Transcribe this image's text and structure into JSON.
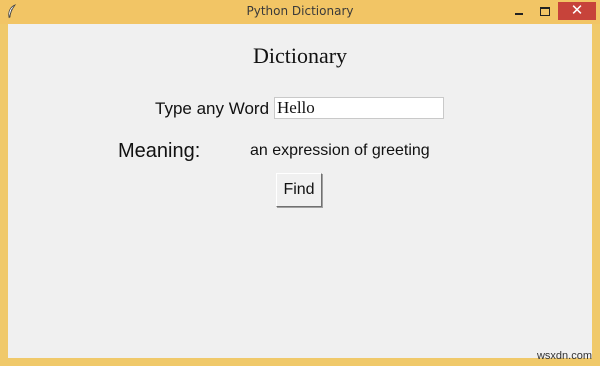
{
  "window": {
    "title": "Python Dictionary",
    "close_glyph": "✕"
  },
  "app": {
    "heading": "Dictionary",
    "word_label": "Type any Word",
    "word_value": "Hello",
    "meaning_label": "Meaning:",
    "meaning_value": "an expression of greeting",
    "find_label": "Find"
  },
  "watermark": "wsxdn.com",
  "icons": {
    "app": "feather-icon",
    "minimize": "minimize-icon",
    "maximize": "maximize-icon",
    "close": "close-icon"
  },
  "colors": {
    "frame": "#f2c565",
    "client_bg": "#f0f0f0",
    "close_button": "#c7433a"
  }
}
